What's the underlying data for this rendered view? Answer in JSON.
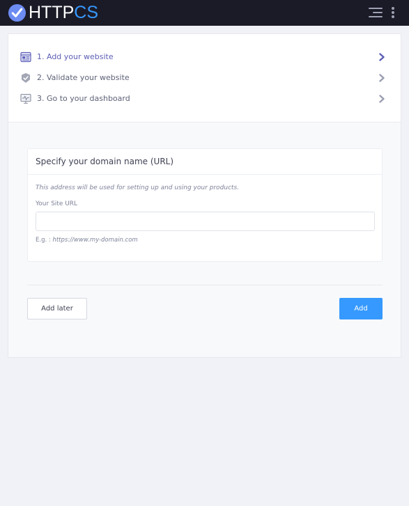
{
  "header": {
    "logo_word_1": "HTTP",
    "logo_word_2": "CS",
    "icons": [
      "check-circle-logo",
      "hamburger-menu-icon",
      "more-vertical-icon"
    ]
  },
  "steps": [
    {
      "label": "1. Add your website",
      "icon": "website-icon",
      "state": "active",
      "color": "#5d5fb6"
    },
    {
      "label": "2. Validate your website",
      "icon": "shield-check-icon",
      "state": "pending",
      "color": "#5e6278"
    },
    {
      "label": "3. Go to your dashboard",
      "icon": "dashboard-monitor-icon",
      "state": "pending",
      "color": "#5e6278"
    }
  ],
  "form": {
    "title": "Specify your domain name (URL)",
    "hint": "This address will be used for setting up and using your products.",
    "field_label": "Your Site URL",
    "url_value": "",
    "url_placeholder": "",
    "example_prefix": "E.g. :",
    "example_value": "https://www.my-domain.com"
  },
  "actions": {
    "add_later_label": "Add later",
    "add_label": "Add"
  },
  "colors": {
    "header_bg": "#1b1b28",
    "accent": "#3699ff",
    "active_step": "#5d5fb6",
    "page_bg": "#f1f2f7"
  }
}
